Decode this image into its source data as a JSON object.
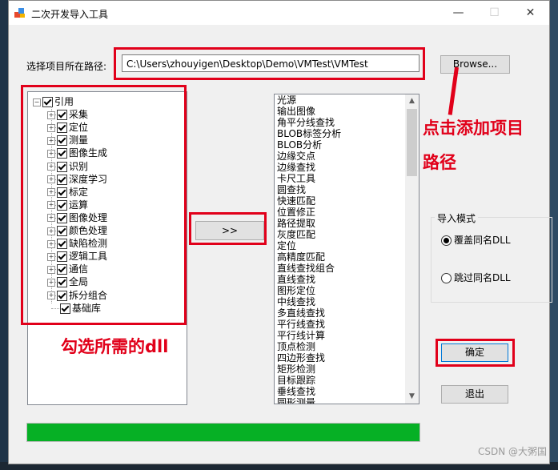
{
  "window": {
    "title": "二次开发导入工具"
  },
  "path": {
    "label": "选择项目所在路径:",
    "value": "C:\\Users\\zhouyigen\\Desktop\\Demo\\VMTest\\VMTest",
    "browse_label": "Browse..."
  },
  "tree": {
    "root": "引用",
    "children": [
      "采集",
      "定位",
      "测量",
      "图像生成",
      "识别",
      "深度学习",
      "标定",
      "运算",
      "图像处理",
      "颜色处理",
      "缺陷检测",
      "逻辑工具",
      "通信",
      "全局",
      "拆分组合",
      "基础库"
    ]
  },
  "transfer_button": ">>",
  "list_items": [
    "光源",
    "输出图像",
    "角平分线查找",
    "BLOB标签分析",
    "BLOB分析",
    "边缘交点",
    "边缘查找",
    "卡尺工具",
    "圆查找",
    "快速匹配",
    "位置修正",
    "路径提取",
    "灰度匹配",
    "定位",
    "高精度匹配",
    "直线查找组合",
    "直线查找",
    "图形定位",
    "中线查找",
    "多直线查找",
    "平行线查找",
    "平行线计算",
    "顶点检测",
    "四边形查找",
    "矩形检测",
    "目标跟踪",
    "垂线查找",
    "圆形测量"
  ],
  "import_mode": {
    "title": "导入模式",
    "options": [
      "覆盖同名DLL",
      "跳过同名DLL"
    ],
    "selected": 0
  },
  "ok_label": "确定",
  "exit_label": "退出",
  "progress": {
    "percent": 100,
    "color": "#06b025"
  },
  "annotations": {
    "line1": "点击添加项目",
    "line2": "路径",
    "tree_hint": "勾选所需的dll",
    "color": "#e1001a"
  },
  "watermark": "CSDN @大粥国"
}
